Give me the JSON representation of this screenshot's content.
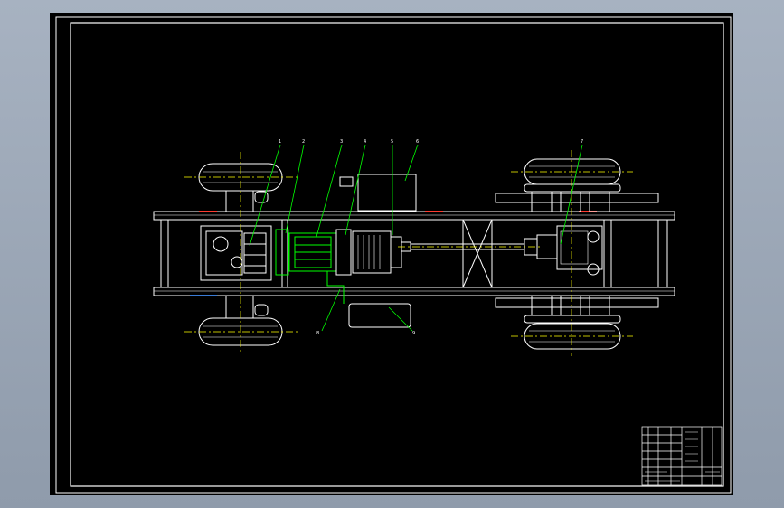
{
  "app": {
    "background_color": "#9aa6b6",
    "canvas_color": "#000000",
    "line_color": "#ffffff",
    "highlight_color": "#00ff00",
    "leader_color": "#00ff00",
    "centerline_color": "#ffff00",
    "hidden_line_color": "#ff3b30",
    "accent_blue": "#3a7bd5"
  },
  "drawing": {
    "balloon_labels": [
      "1",
      "2",
      "3",
      "4",
      "5",
      "6",
      "7",
      "8",
      "9"
    ]
  },
  "title_block": {
    "rows": 7
  }
}
